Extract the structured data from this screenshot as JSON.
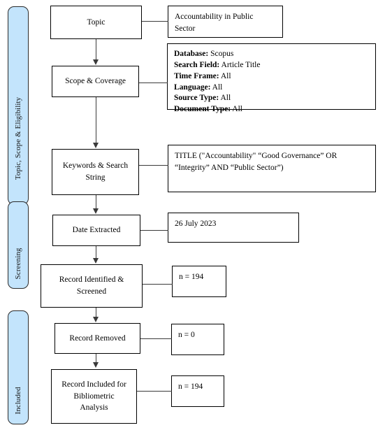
{
  "diagram": {
    "title": "PRISMA-style bibliometric search flow",
    "colors": {
      "pill_fill": "#c3e4fc",
      "pill_border": "#2b2b2b",
      "box_border": "#000000",
      "connector": "#3a3a3a",
      "text": "#000000",
      "background": "#ffffff"
    },
    "stages": [
      {
        "id": "stage-topic-scope-eligibility",
        "label": "Topic, Scope & Eligibility"
      },
      {
        "id": "stage-screening",
        "label": "Screening"
      },
      {
        "id": "stage-included",
        "label": "Included"
      }
    ],
    "steps": [
      {
        "id": "step-topic",
        "label": "Topic"
      },
      {
        "id": "step-scope-coverage",
        "label": "Scope & Coverage"
      },
      {
        "id": "step-keywords-search-string",
        "label": "Keywords & Search String"
      },
      {
        "id": "step-date-extracted",
        "label": "Date Extracted"
      },
      {
        "id": "step-record-identified-screened",
        "label": "Record Identified & Screened"
      },
      {
        "id": "step-record-removed",
        "label": "Record Removed"
      },
      {
        "id": "step-record-included",
        "label": "Record Included for Bibliometric Analysis"
      }
    ],
    "annotations": {
      "topic_value": "Accountability in Public Sector",
      "search_parameters": [
        {
          "label": "Database:",
          "value": "Scopus"
        },
        {
          "label": "Search Field:",
          "value": "Article Title"
        },
        {
          "label": "Time Frame:",
          "value": "All"
        },
        {
          "label": "Language:",
          "value": "All"
        },
        {
          "label": "Source Type:",
          "value": "All"
        },
        {
          "label": "Document Type:",
          "value": "All"
        }
      ],
      "search_string_line1": "TITLE (\"Accountability\"  “Good Governance”  OR",
      "search_string_line2": "“Integrity”  AND “Public Sector”)",
      "date_extracted_value": "26 July 2023",
      "records_identified_value": "n = 194",
      "records_removed_value": "n = 0",
      "records_included_value": "n = 194"
    }
  }
}
